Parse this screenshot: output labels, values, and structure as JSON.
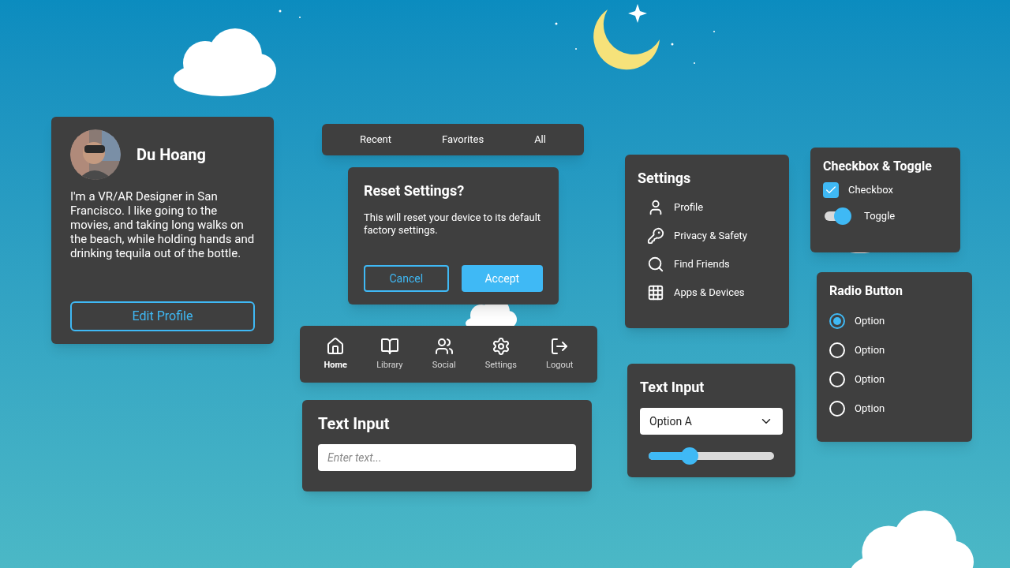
{
  "profile": {
    "name": "Du Hoang",
    "bio": "I'm a VR/AR Designer in San Francisco. I like going to the movies, and taking long walks on the beach, while holding hands and drinking tequila out of the bottle.",
    "button": "Edit Profile"
  },
  "tabs": [
    {
      "label": "Recent",
      "selected": false
    },
    {
      "label": "Favorites",
      "selected": false
    },
    {
      "label": "All",
      "selected": false
    }
  ],
  "dialog": {
    "title": "Reset Settings?",
    "message": "This will reset your device to its default factory settings.",
    "buttons": [
      {
        "label": "Cancel",
        "kind": "outline"
      },
      {
        "label": "Accept",
        "kind": "filled"
      }
    ]
  },
  "nav": [
    {
      "label": "Home",
      "selected": true
    },
    {
      "label": "Library",
      "selected": false
    },
    {
      "label": "Social",
      "selected": false
    },
    {
      "label": "Settings",
      "selected": false
    },
    {
      "label": "Logout",
      "selected": false
    }
  ],
  "text_input": {
    "title": "Text Input",
    "placeholder": "Enter text..."
  },
  "settings": {
    "title": "Settings",
    "items": [
      {
        "label": "Profile"
      },
      {
        "label": "Privacy & Safety"
      },
      {
        "label": "Find Friends"
      },
      {
        "label": "Apps & Devices"
      }
    ]
  },
  "select_panel": {
    "title": "Text Input",
    "value": "Option A",
    "slider": {
      "level": 0.33
    }
  },
  "checkbox_panel": {
    "title": "Checkbox & Toggle",
    "checkbox": {
      "label": "Checkbox",
      "checked": true
    },
    "toggle": {
      "label": "Toggle",
      "on": true
    }
  },
  "radio_panel": {
    "title": "Radio Button",
    "options": [
      {
        "label": "Option",
        "selected": true
      },
      {
        "label": "Option",
        "selected": false
      },
      {
        "label": "Option",
        "selected": false
      },
      {
        "label": "Option",
        "selected": false
      }
    ]
  }
}
